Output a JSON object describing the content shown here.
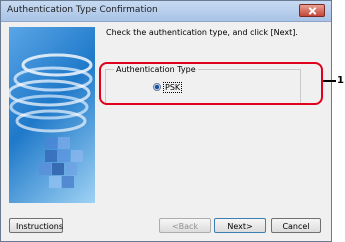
{
  "window": {
    "title": "Authentication Type Confirmation"
  },
  "main": {
    "instruction": "Check the authentication type, and click [Next].",
    "group_label": "Authentication Type",
    "option_label": "PSK",
    "option_selected": true
  },
  "callout": {
    "number": "1"
  },
  "buttons": {
    "instructions": "Instructions",
    "back": "<Back",
    "next": "Next>",
    "cancel": "Cancel"
  },
  "icons": [
    "close-icon",
    "radio-selected-icon"
  ]
}
